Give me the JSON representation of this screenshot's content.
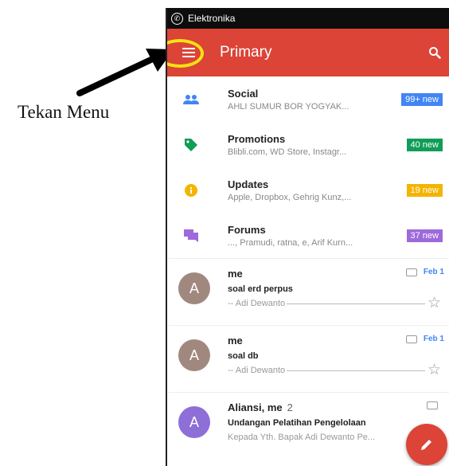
{
  "annotation": {
    "text": "Tekan Menu"
  },
  "statusbar": {
    "app_name": "Elektronika",
    "app_icon": "whatsapp-icon"
  },
  "toolbar": {
    "title": "Primary",
    "menu_icon": "hamburger-menu-icon",
    "search_icon": "search-icon"
  },
  "categories": [
    {
      "title": "Social",
      "subtitle": "AHLI SUMUR BOR YOGYAK...",
      "badge": "99+ new",
      "badge_color": "#4285f4",
      "icon": "people-icon",
      "icon_color": "#4285f4"
    },
    {
      "title": "Promotions",
      "subtitle": "Blibli.com, WD Store, Instagr...",
      "badge": "40 new",
      "badge_color": "#0f9d58",
      "icon": "tag-icon",
      "icon_color": "#0f9d58"
    },
    {
      "title": "Updates",
      "subtitle": "Apple, Dropbox, Gehrig Kunz,...",
      "badge": "19 new",
      "badge_color": "#f4b400",
      "icon": "info-icon",
      "icon_color": "#f4b400"
    },
    {
      "title": "Forums",
      "subtitle": "..., Pramudi, ratna, e, Arif Kurn...",
      "badge": "37 new",
      "badge_color": "#9e69db",
      "icon": "forum-icon",
      "icon_color": "#9e69db"
    }
  ],
  "emails": [
    {
      "avatar": "A",
      "avatar_color": "#a1887f",
      "sender": "me",
      "count": "",
      "subject": "soal erd perpus",
      "snippet": "-- Adi Dewanto",
      "date": "Feb 1"
    },
    {
      "avatar": "A",
      "avatar_color": "#a1887f",
      "sender": "me",
      "count": "",
      "subject": "soal db",
      "snippet": "-- Adi Dewanto",
      "date": "Feb 1"
    },
    {
      "avatar": "A",
      "avatar_color": "#8e6ed7",
      "sender": "Aliansi, me",
      "count": "2",
      "subject": "Undangan Pelatihan Pengelolaan",
      "snippet": "Kepada Yth. Bapak Adi Dewanto Pe...",
      "date": ""
    }
  ],
  "fab": {
    "icon": "compose-pencil-icon"
  }
}
